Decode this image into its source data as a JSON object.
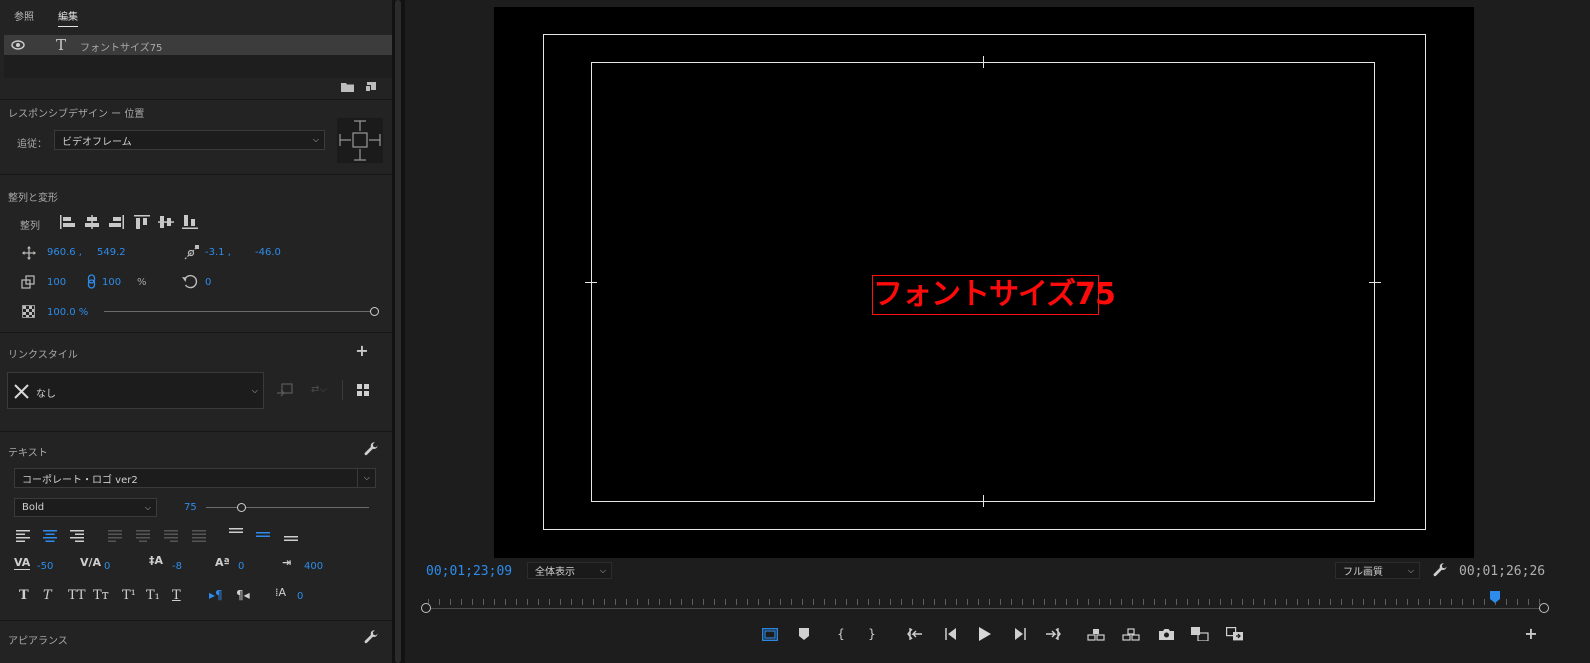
{
  "tabs": {
    "browse": "参照",
    "edit": "編集"
  },
  "layer": {
    "name": "フォントサイズ75"
  },
  "responsive": {
    "title": "レスポンシブデザイン ー 位置",
    "follow_label": "追従：",
    "follow_value": "ビデオフレーム"
  },
  "align": {
    "title": "整列と変形",
    "align_label": "整列",
    "pos_x": "960.6 ,",
    "pos_y": "549.2",
    "anchor_x": "-3.1 ,",
    "anchor_y": "-46.0",
    "scale": "100",
    "scale2": "100",
    "percent": "%",
    "rotation": "0",
    "opacity": "100.0 %"
  },
  "link_style": {
    "title": "リンクスタイル",
    "value": "なし"
  },
  "text": {
    "title": "テキスト",
    "font": "コーポレート・ロゴ ver2",
    "style": "Bold",
    "size": "75",
    "size_fraction": 0.22,
    "kerning": "-50",
    "tracking": "0",
    "leading": "-8",
    "baseline": "0",
    "tab_width": "400",
    "tsume": "0",
    "fmt_buttons": [
      "T",
      "T",
      "TT",
      "Tᴛ",
      "T¹",
      "T₁",
      "T"
    ]
  },
  "appearance": {
    "title": "アピアランス"
  },
  "program": {
    "title_text": "フォントサイズ75",
    "timecode_current": "00;01;23;09",
    "timecode_duration": "00;01;26;26",
    "zoom": "全体表示",
    "quality": "フル画質",
    "playhead_fraction": 0.958
  },
  "colors": {
    "accent": "#2d8ceb",
    "title_red": "#ff0a0a",
    "safe_lines": "#e6e6e6"
  },
  "icons": {
    "eye": "eye-icon",
    "type": "type-tool-icon",
    "folder": "folder-icon",
    "new_item": "new-item-icon",
    "wrench": "wrench-icon",
    "plus": "plus-icon"
  }
}
